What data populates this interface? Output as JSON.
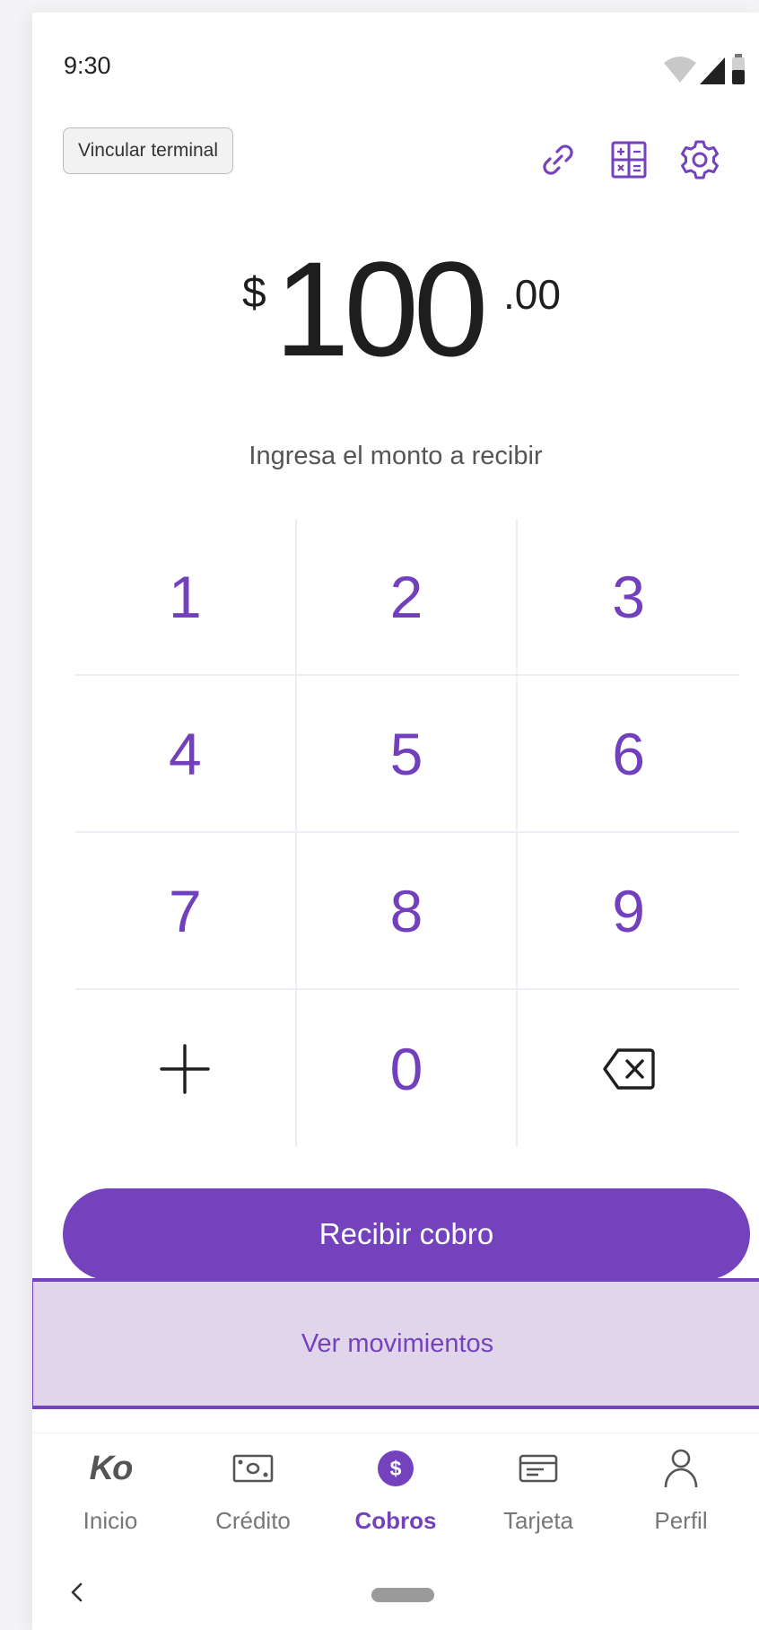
{
  "status": {
    "time": "9:30"
  },
  "header": {
    "link_terminal_label": "Vincular terminal"
  },
  "amount": {
    "currency": "$",
    "integer": "100",
    "decimal": ".00"
  },
  "hint": "Ingresa el monto a recibir",
  "keypad": {
    "k1": "1",
    "k2": "2",
    "k3": "3",
    "k4": "4",
    "k5": "5",
    "k6": "6",
    "k7": "7",
    "k8": "8",
    "k9": "9",
    "k0": "0"
  },
  "actions": {
    "primary_label": "Recibir cobro",
    "secondary_label": "Ver movimientos"
  },
  "nav": {
    "inicio_logo": "Ko",
    "inicio": "Inicio",
    "credito": "Crédito",
    "cobros": "Cobros",
    "tarjeta": "Tarjeta",
    "perfil": "Perfil",
    "cobros_icon_glyph": "$"
  },
  "colors": {
    "accent": "#7442bd",
    "accent_light": "#e0d5ea"
  }
}
